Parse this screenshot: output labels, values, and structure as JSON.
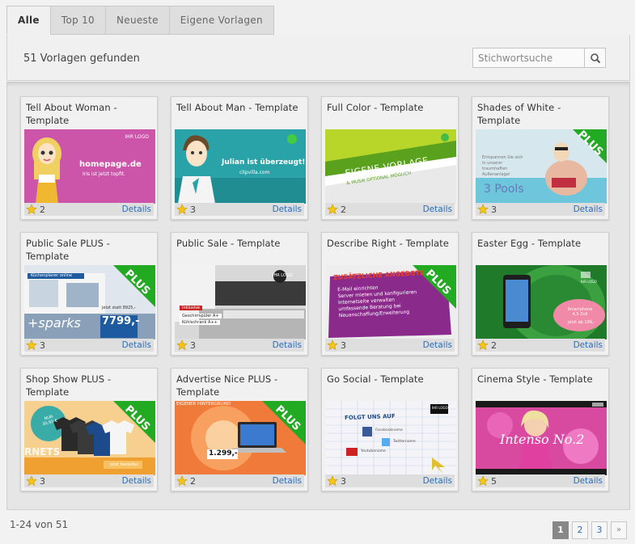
{
  "tabs": [
    {
      "label": "Alle",
      "active": true
    },
    {
      "label": "Top 10",
      "active": false
    },
    {
      "label": "Neueste",
      "active": false
    },
    {
      "label": "Eigene Vorlagen",
      "active": false
    }
  ],
  "results": {
    "count_text": "51 Vorlagen gefunden"
  },
  "search": {
    "placeholder": "Stichwortsuche"
  },
  "details_label": "Details",
  "cards": [
    {
      "title": "Tell About Woman - Template",
      "rating": "2",
      "thumb": {
        "main": "homepage.de",
        "sub": "Iris ist jetzt topfit.",
        "logo": "IHR LOGO"
      }
    },
    {
      "title": "Tell About Man - Template",
      "rating": "3",
      "thumb": {
        "main": "Julian ist überzeugt!",
        "sub": "clipvilla.com"
      }
    },
    {
      "title": "Full Color - Template",
      "rating": "2",
      "thumb": {
        "main": "EIGENE VORLAGE",
        "sub": "& MUSIK OPTIONAL MÖGLICH"
      }
    },
    {
      "title": "Shades of White - Template",
      "rating": "3",
      "thumb": {
        "main": "3 Pools",
        "sub": "Entspannen Sie sich in unserer traumhaften Außenanlage!",
        "badge": "PLUS"
      }
    },
    {
      "title": "Public Sale PLUS - Template",
      "rating": "3",
      "thumb": {
        "main": "+sparks",
        "price": "7799,-",
        "badge": "PLUS",
        "caption": "Küchenplaner online",
        "price_caption": "jetzt statt 8925,-"
      }
    },
    {
      "title": "Public Sale - Template",
      "rating": "3",
      "thumb": {
        "label1": "Inklusive",
        "label2": "Geschirrspüler A+",
        "label3": "Kühlschrank A++",
        "logo": "IHR LOGO"
      }
    },
    {
      "title": "Describe Right - Template",
      "rating": "3",
      "thumb": {
        "main": "ZUSÄTZLICHE ANGEBOTE",
        "sub": "E-Mail einrichten\nServer mieten und konfigurieren\nInternetseite verwalten\numfassende Beratung bei\nNeuanschaffung/Erweiterung",
        "badge": "PLUS"
      }
    },
    {
      "title": "Easter Egg - Template",
      "rating": "2",
      "thumb": {
        "sub": "Smartphone 4,5 Zoll",
        "sub2": "jetzt ab 199,-",
        "logo": "IHR LOGO"
      }
    },
    {
      "title": "Shop Show PLUS - Template",
      "rating": "3",
      "thumb": {
        "main": "NUR 30,95 €",
        "sub": "jetzt bestellen",
        "badge": "PLUS",
        "side": "RNETS"
      }
    },
    {
      "title": "Advertise Nice PLUS - Template",
      "rating": "2",
      "thumb": {
        "main": "EIGENER HINTERGRUND",
        "price": "1.299,-",
        "badge": "PLUS"
      }
    },
    {
      "title": "Go Social - Template",
      "rating": "3",
      "thumb": {
        "main": "FOLGT UNS AUF",
        "logo": "IHR LOGO",
        "s1": "Facebookname",
        "s2": "Twittername",
        "s3": "Youtubename"
      }
    },
    {
      "title": "Cinema Style - Template",
      "rating": "5",
      "thumb": {
        "main": "Intenso No.2"
      }
    }
  ],
  "footer": {
    "range_text": "1-24 von 51"
  },
  "pagination": [
    "1",
    "2",
    "3",
    "»"
  ],
  "colors": {
    "link": "#2a6ebb",
    "plus_badge": "#22aa22",
    "star": "#f5c518"
  }
}
